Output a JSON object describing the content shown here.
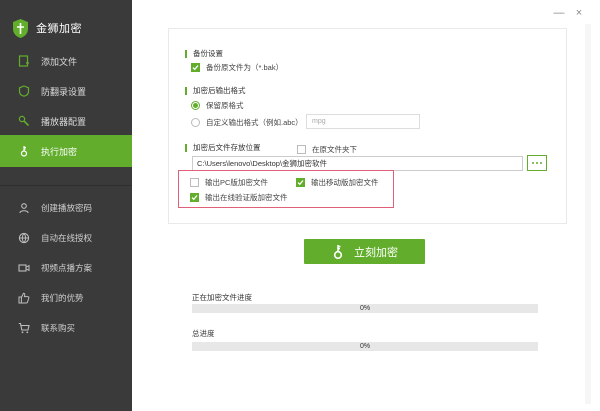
{
  "app": {
    "title": "金狮加密"
  },
  "colors": {
    "accent": "#62ad2c",
    "sidebar_bg": "#3a3a3a",
    "highlight_border": "#e0607a"
  },
  "sidebar": {
    "items": [
      {
        "label": "添加文件",
        "icon": "add-file-icon"
      },
      {
        "label": "防翻录设置",
        "icon": "shield-icon"
      },
      {
        "label": "播放器配置",
        "icon": "wrench-icon"
      },
      {
        "label": "执行加密",
        "icon": "key-icon",
        "active": true
      },
      {
        "label": "创建播放密码",
        "icon": "user-icon"
      },
      {
        "label": "自动在线授权",
        "icon": "globe-icon"
      },
      {
        "label": "视频点播方案",
        "icon": "video-icon"
      },
      {
        "label": "我们的优势",
        "icon": "thumbs-up-icon"
      },
      {
        "label": "联系购买",
        "icon": "cart-icon"
      }
    ]
  },
  "window_controls": {
    "minimize": "—",
    "close": "×"
  },
  "settings": {
    "backup": {
      "title": "备份设置",
      "backup_checkbox": {
        "label": "备份原文件为（*.bak）",
        "checked": true
      }
    },
    "output_format": {
      "title": "加密后输出格式",
      "keep_original": {
        "label": "保留原格式",
        "checked": true
      },
      "custom": {
        "label": "自定义输出格式（例如.abc）",
        "checked": false
      },
      "custom_input": {
        "placeholder": "mpg"
      }
    },
    "save_location": {
      "title": "加密后文件存放位置",
      "in_source_folder": {
        "label": "在原文件夹下",
        "checked": false
      },
      "path": "C:\\Users\\lenovo\\Desktop\\金狮加密软件",
      "browse_label": "···"
    },
    "output_versions": {
      "pc": {
        "label": "输出PC版加密文件",
        "checked": false
      },
      "mobile": {
        "label": "输出移动版加密文件",
        "checked": true
      },
      "online": {
        "label": "输出在线验证版加密文件",
        "checked": true
      }
    }
  },
  "encrypt_button": {
    "label": "立刻加密"
  },
  "progress": {
    "current": {
      "label": "正在加密文件进度",
      "value": 0,
      "text": "0%"
    },
    "total": {
      "label": "总进度",
      "value": 0,
      "text": "0%"
    }
  }
}
